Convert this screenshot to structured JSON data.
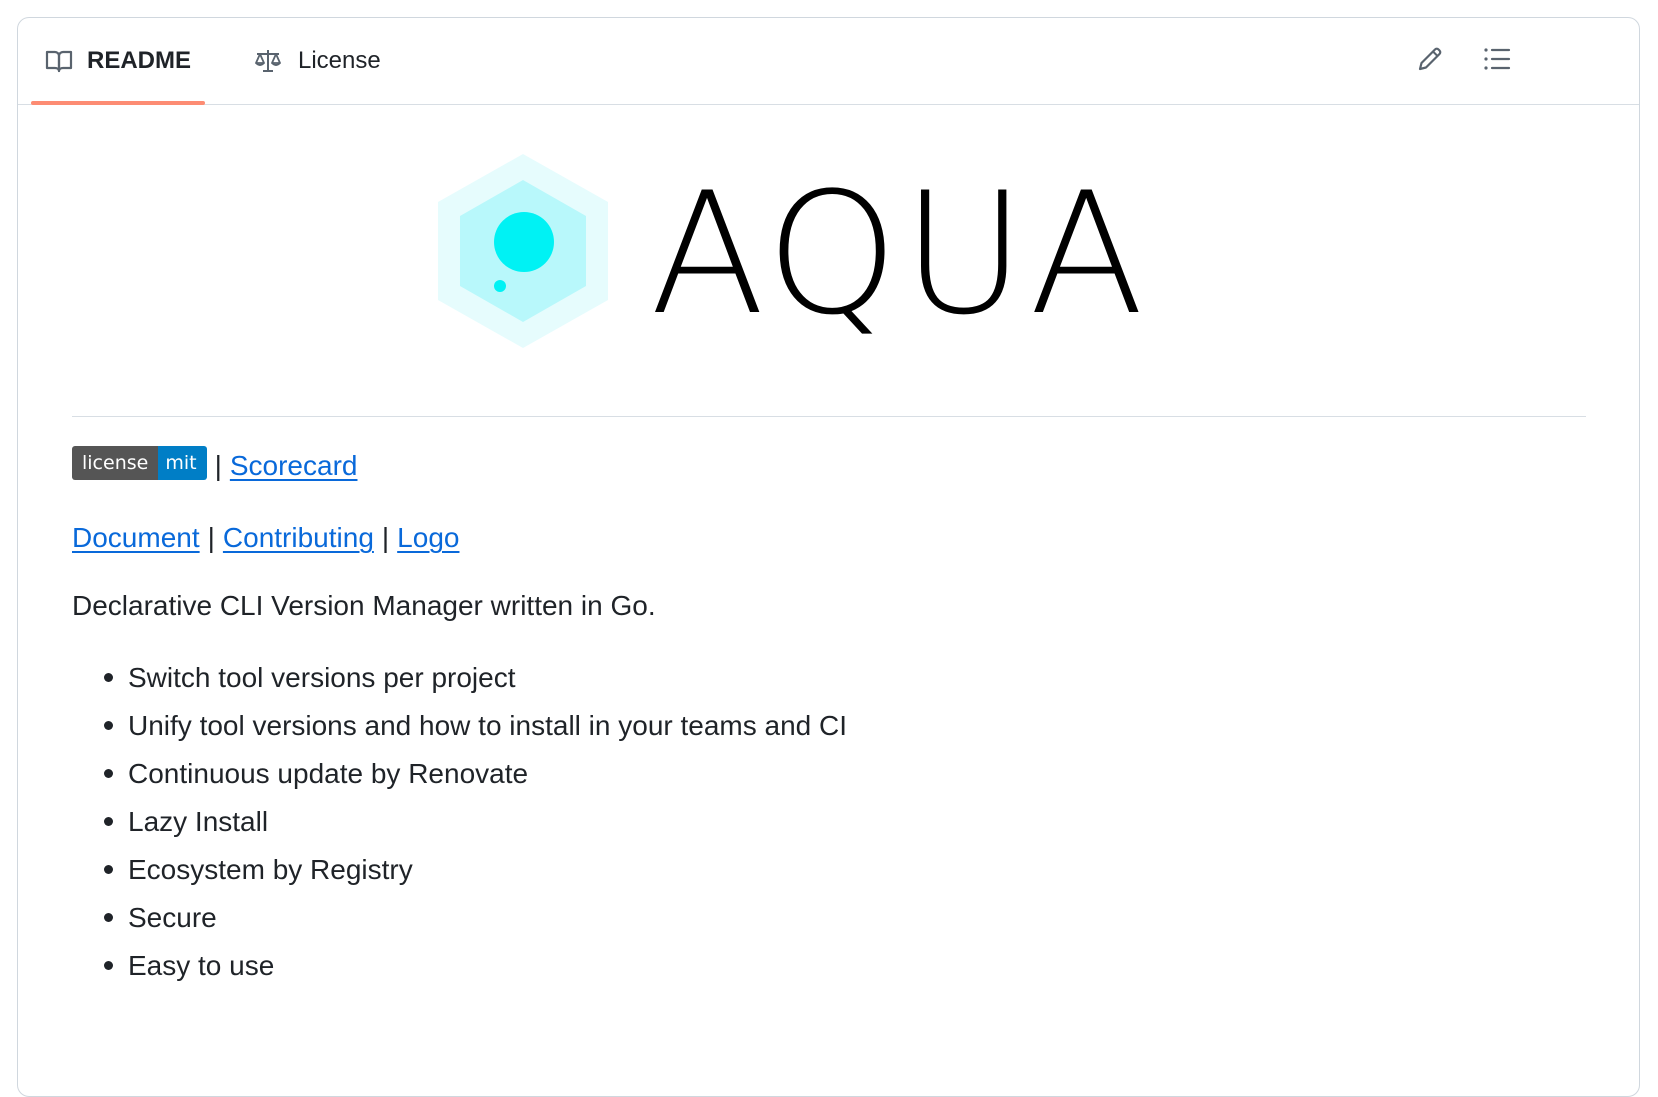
{
  "tabs": {
    "readme_label": "README",
    "license_label": "License",
    "readme_icon": "book-icon",
    "license_icon": "law-scale-icon",
    "accent_color": "#fd8c73"
  },
  "toolbar": {
    "edit_icon": "pencil-icon",
    "outline_icon": "list-unordered-icon"
  },
  "readme": {
    "logo_text": "AQUA",
    "logo_colors": {
      "hex_outer": "#e6fcfd",
      "hex_inner": "#b8f8fb",
      "dot": "#00f2f4",
      "text": "#000000"
    },
    "badge": {
      "left": "license",
      "right": "mit",
      "left_color": "#555555",
      "right_color": "#007ec6"
    },
    "separator": "|",
    "scorecard_link": "Scorecard",
    "links": {
      "document": "Document",
      "contributing": "Contributing",
      "logo": "Logo"
    },
    "link_color": "#0969da",
    "description": "Declarative CLI Version Manager written in Go.",
    "features": [
      "Switch tool versions per project",
      "Unify tool versions and how to install in your teams and CI",
      "Continuous update by Renovate",
      "Lazy Install",
      "Ecosystem by Registry",
      "Secure",
      "Easy to use"
    ]
  }
}
